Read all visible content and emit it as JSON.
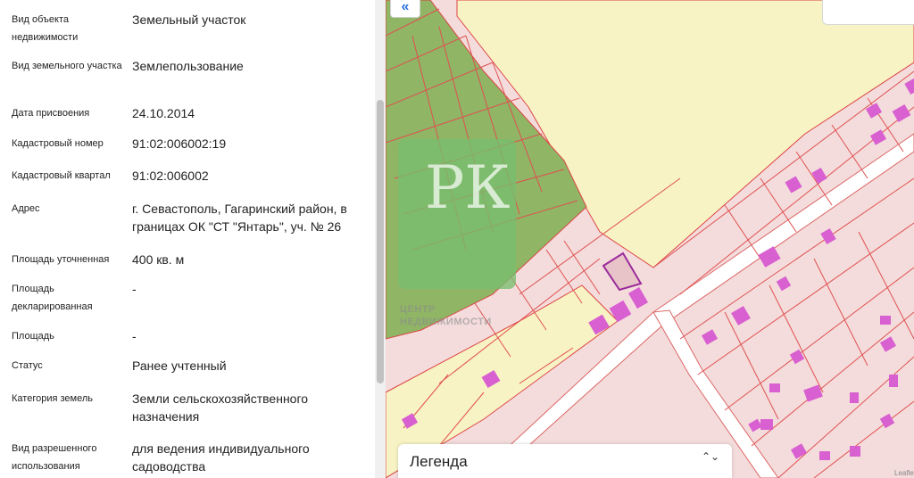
{
  "properties": [
    {
      "label": "Вид объекта недвижимости",
      "value": "Земельный участок"
    },
    {
      "label": "Вид земельного участка",
      "value": "Землепользование"
    },
    {
      "label": "Дата присвоения",
      "value": "24.10.2014"
    },
    {
      "label": "Кадастровый номер",
      "value": "91:02:006002:19"
    },
    {
      "label": "Кадастровый квартал",
      "value": "91:02:006002"
    },
    {
      "label": "Адрес",
      "value": "г. Севастополь, Гагаринский район, в границах ОК \"СТ \"Янтарь\", уч. № 26"
    },
    {
      "label": "Площадь уточненная",
      "value": "400 кв. м"
    },
    {
      "label": "Площадь декларированная",
      "value": "-"
    },
    {
      "label": "Площадь",
      "value": "-"
    },
    {
      "label": "Статус",
      "value": "Ранее учтенный"
    },
    {
      "label": "Категория земель",
      "value": "Земли сельскохозяйственного назначения"
    },
    {
      "label": "Вид разрешенного использования",
      "value": "для ведения индивидуального садоводства"
    }
  ],
  "map": {
    "collapse_icon": "double-chevron-left-icon",
    "collapse_glyph": "«",
    "watermark": {
      "letters": "РК",
      "text_line1": "ЦЕНТР",
      "text_line2": "НЕДВИЖИМОСТИ"
    },
    "legend": {
      "title": "Легенда",
      "toggle_icon": "chevron-up-down-icon",
      "toggle_glyph": "⌃⌄"
    },
    "attribution": "Leaflet",
    "colors": {
      "parcel_fill": "#f4dcdc",
      "parcel_border": "#e05050",
      "yellow_zone": "#f8f3c4",
      "green_zone": "#8fb565",
      "building": "#d860d0",
      "selected_border": "#9b2a9b",
      "road": "#ffffff"
    }
  }
}
